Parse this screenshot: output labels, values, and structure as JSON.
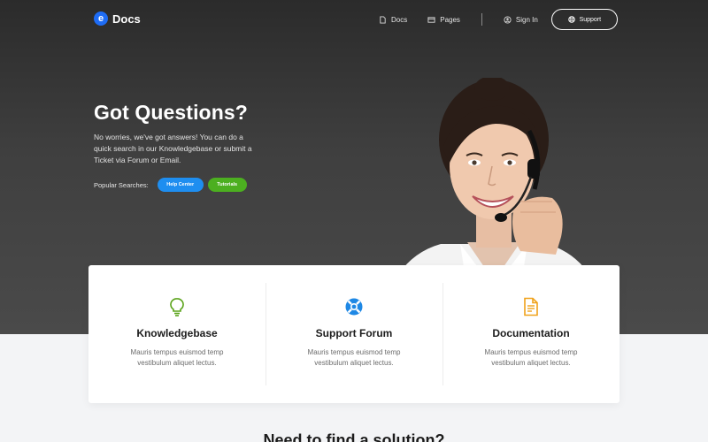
{
  "brand": {
    "logo_letter": "e",
    "name": "Docs"
  },
  "nav": {
    "docs_label": "Docs",
    "pages_label": "Pages",
    "signin_label": "Sign In",
    "support_label": "Support"
  },
  "hero": {
    "title": "Got Questions?",
    "description": "No worries, we've got answers! You can do a quick search in our Knowledgebase or submit a Ticket via Forum or Email.",
    "popular_label": "Popular Searches:",
    "tags": [
      "Help Center",
      "Tutorials"
    ]
  },
  "cards": [
    {
      "title": "Knowledgebase",
      "text": "Mauris tempus euismod temp vestibulum aliquet lectus.",
      "icon": "lightbulb-icon",
      "color": "#5aa31a"
    },
    {
      "title": "Support Forum",
      "text": "Mauris tempus euismod temp vestibulum aliquet lectus.",
      "icon": "lifebuoy-icon",
      "color": "#1e88e5"
    },
    {
      "title": "Documentation",
      "text": "Mauris tempus euismod temp vestibulum aliquet lectus.",
      "icon": "document-icon",
      "color": "#f0a21a"
    }
  ],
  "bottom_heading": "Need to find a solution?",
  "colors": {
    "brand": "#1e6cf5",
    "pill_blue": "#1e8ef0",
    "pill_green": "#4caf20"
  }
}
